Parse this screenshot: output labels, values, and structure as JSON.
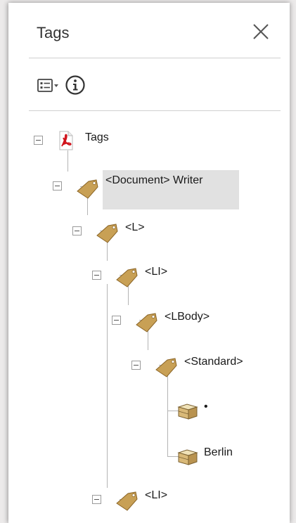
{
  "panel": {
    "title": "Tags",
    "close_icon": "close-icon",
    "toolbar": {
      "options_icon": "options-menu-icon",
      "info_icon": "info-icon"
    }
  },
  "tree": {
    "nodes": [
      {
        "label": "Tags",
        "icon": "pdf-icon",
        "expanded": true,
        "selected": false
      },
      {
        "label": "<Document> Writer",
        "icon": "tag-icon",
        "expanded": true,
        "selected": true
      },
      {
        "label": "<L>",
        "icon": "tag-icon",
        "expanded": true,
        "selected": false
      },
      {
        "label": "<LI>",
        "icon": "tag-icon",
        "expanded": true,
        "selected": false
      },
      {
        "label": "<LBody>",
        "icon": "tag-icon",
        "expanded": true,
        "selected": false
      },
      {
        "label": "<Standard>",
        "icon": "tag-icon",
        "expanded": true,
        "selected": false
      },
      {
        "label": "•",
        "icon": "content-box-icon",
        "selected": false
      },
      {
        "label": "Berlin",
        "icon": "content-box-icon",
        "selected": false
      },
      {
        "label": "<LI>",
        "icon": "tag-icon",
        "expanded": true,
        "selected": false
      }
    ]
  },
  "colors": {
    "tag_body": "#c8a055",
    "pdf_red": "#d0121b",
    "selection": "#e1e1e1",
    "tree_line": "#b4b4b4"
  }
}
